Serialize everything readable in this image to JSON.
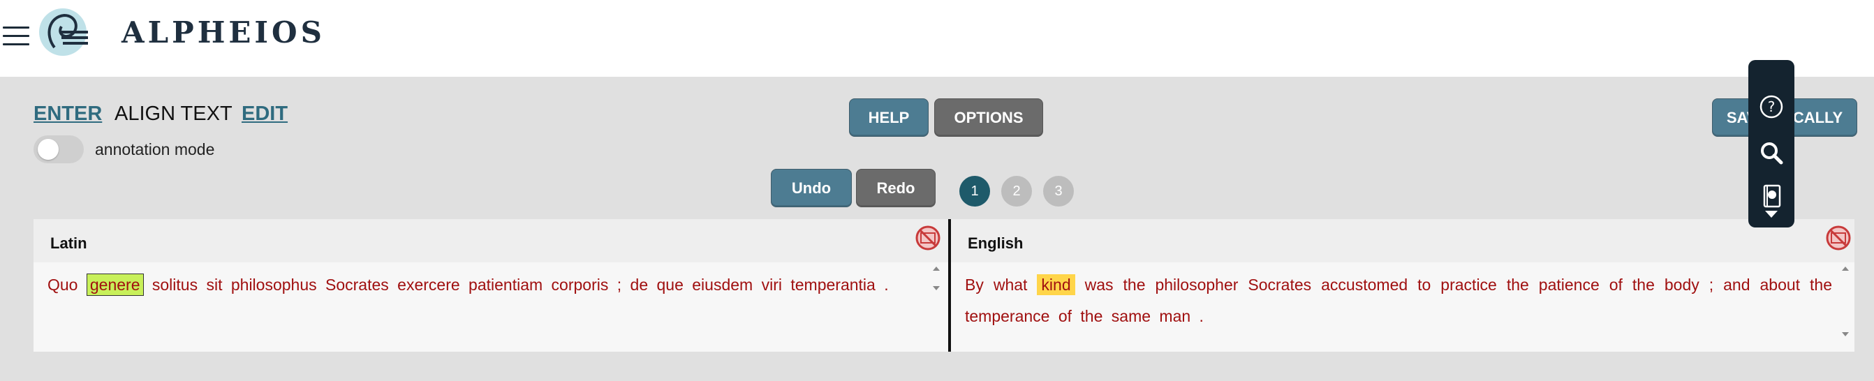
{
  "header": {
    "logo_text": "ALPHEIOS"
  },
  "nav": {
    "enter": "ENTER",
    "align": "ALIGN TEXT",
    "edit": "EDIT"
  },
  "annotation": {
    "label": "annotation mode",
    "enabled": false
  },
  "buttons": {
    "help": "HELP",
    "options": "OPTIONS",
    "save": "SAVE LOCALLY",
    "undo": "Undo",
    "redo": "Redo"
  },
  "steps": [
    "1",
    "2",
    "3"
  ],
  "active_step": "1",
  "toolbar": {
    "icons": [
      "help-icon",
      "search-icon",
      "book-icon",
      "chevron-down-icon"
    ]
  },
  "panes": {
    "left": {
      "title": "Latin",
      "words_before": "Quo",
      "highlight": "genere",
      "words_after": "solitus sit philosophus Socrates exercere patientiam corporis ; de que eiusdem viri temperantia ."
    },
    "right": {
      "title": "English",
      "words_before": "By what",
      "highlight": "kind",
      "words_after": "was the philosopher Socrates accustomed to practice the patience of the body ; and about the temperance of the same man ."
    }
  },
  "colors": {
    "accent": "#4d7c92",
    "dark": "#14232f",
    "text_red": "#a01010",
    "highlight_green": "#c8f05a",
    "highlight_yellow": "#ffd54a"
  }
}
